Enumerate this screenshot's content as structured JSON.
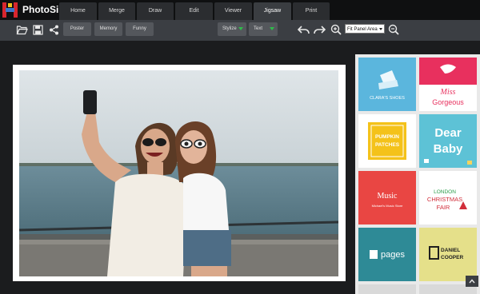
{
  "app": {
    "name": "PhotoSir"
  },
  "tabs": [
    {
      "label": "Home"
    },
    {
      "label": "Merge"
    },
    {
      "label": "Draw"
    },
    {
      "label": "Edit"
    },
    {
      "label": "Viewer"
    },
    {
      "label": "Jigsaw",
      "active": true
    },
    {
      "label": "Print"
    }
  ],
  "toolbar": {
    "open_icon": "folder-open-icon",
    "save_icon": "floppy-disk-icon",
    "share_icon": "share-icon",
    "poster_label": "Poster",
    "memory_label": "Memory",
    "funny_label": "Funny",
    "stylize_label": "Stylize",
    "text_label": "Text",
    "undo_icon": "undo-icon",
    "redo_icon": "redo-icon",
    "zoom_in_icon": "zoom-in-icon",
    "zoom_out_icon": "zoom-out-icon",
    "zoom_select_value": "Fit Panel Area"
  },
  "templates": [
    {
      "brand": "CLARA'S SHOES",
      "bg": "#5bb6dd"
    },
    {
      "line1": "Miss",
      "line2": "Gorgeous",
      "bg": "#ffffff",
      "accent": "#e8305e"
    },
    {
      "line1": "PUMPKIN",
      "line2": "PATCHES",
      "bg": "#ffffff",
      "accent": "#f4c21a"
    },
    {
      "line1": "Dear",
      "line2": "Baby",
      "bg": "#5dc2d6"
    },
    {
      "line1": "Music",
      "line2": "Michael's Music Store",
      "bg": "#e94643"
    },
    {
      "line1": "LONDON",
      "line2": "CHRISTMAS",
      "line3": "FAIR",
      "bg": "#ffffff"
    },
    {
      "line1": "pages",
      "bg": "#2e8a96"
    },
    {
      "line1": "DANIEL",
      "line2": "COOPER",
      "bg": "#e5e08a"
    }
  ],
  "colors": {
    "topbar": "#0f1011",
    "toolbar": "#3b3e43",
    "accent_green": "#2ebd4a"
  }
}
